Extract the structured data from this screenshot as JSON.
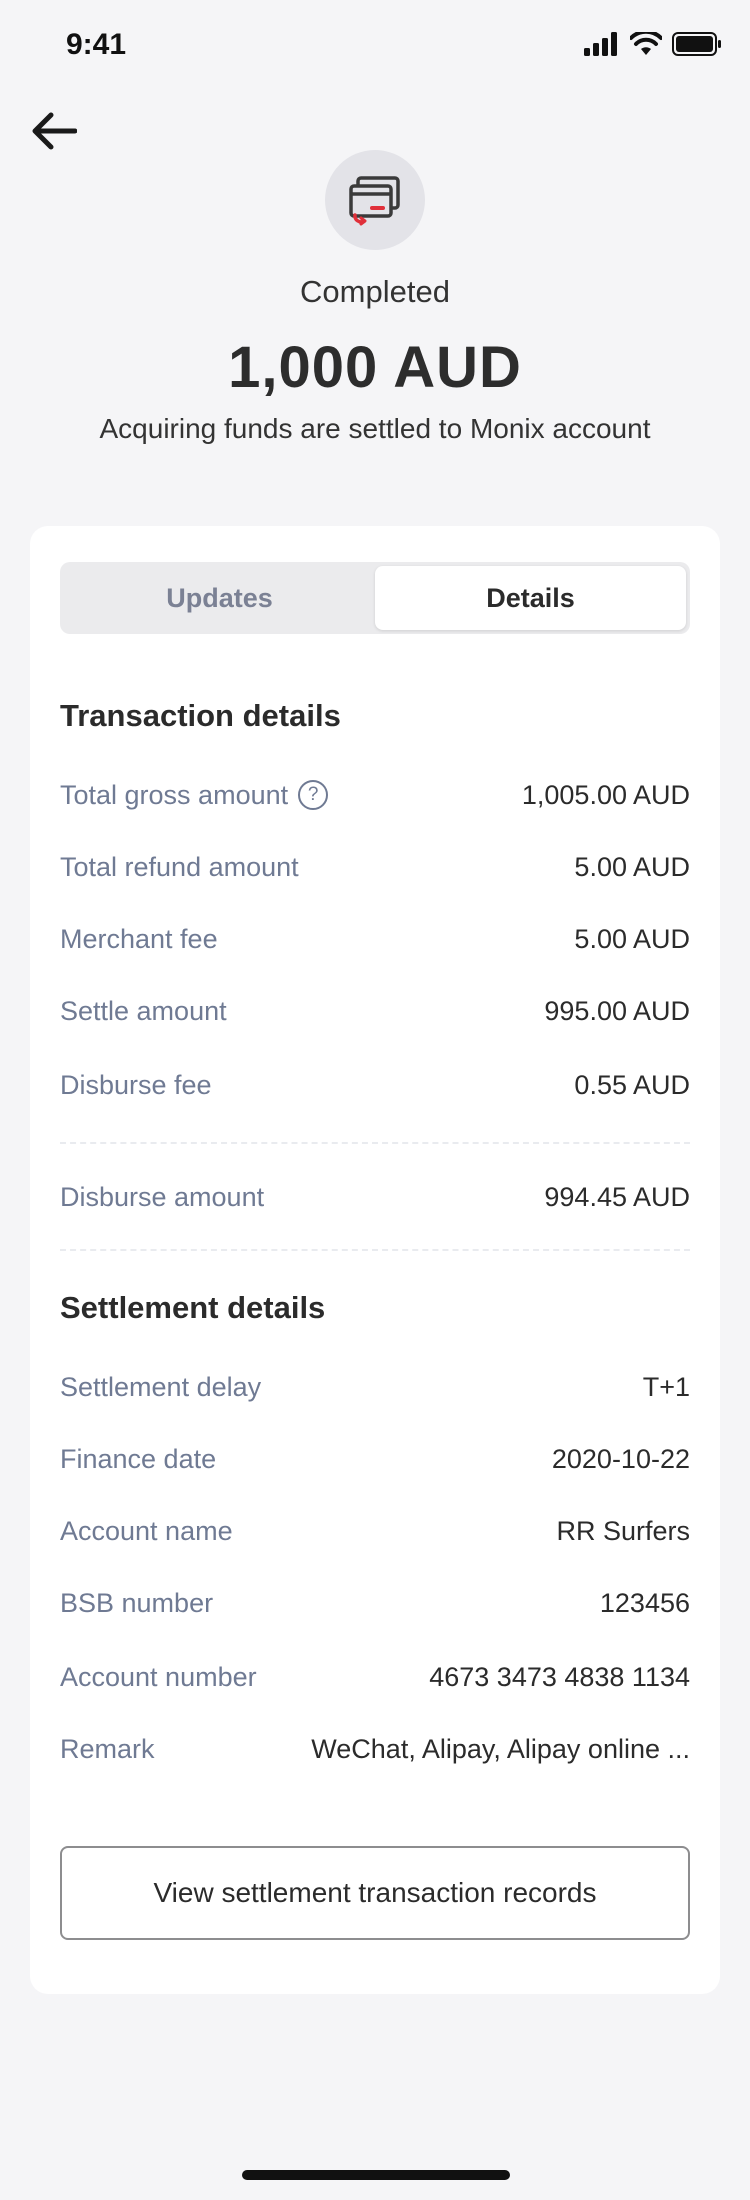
{
  "status_bar": {
    "time": "9:41"
  },
  "hero": {
    "status": "Completed",
    "amount": "1,000 AUD",
    "subtitle": "Acquiring funds are settled to Monix account"
  },
  "tabs": [
    {
      "label": "Updates",
      "active": false
    },
    {
      "label": "Details",
      "active": true
    }
  ],
  "transaction": {
    "title": "Transaction details",
    "help_glyph": "?",
    "rows": [
      {
        "label": "Total gross amount",
        "value": "1,005.00 AUD"
      },
      {
        "label": "Total refund amount",
        "value": "5.00 AUD"
      },
      {
        "label": "Merchant fee",
        "value": "5.00 AUD"
      },
      {
        "label": "Settle amount",
        "value": "995.00 AUD"
      },
      {
        "label": "Disburse fee",
        "value": "0.55 AUD"
      },
      {
        "label": "Disburse amount",
        "value": "994.45 AUD"
      }
    ]
  },
  "settlement": {
    "title": "Settlement details",
    "rows": [
      {
        "label": "Settlement delay",
        "value": "T+1"
      },
      {
        "label": "Finance date",
        "value": "2020-10-22"
      },
      {
        "label": "Account name",
        "value": "RR Surfers"
      },
      {
        "label": "BSB number",
        "value": "123456"
      },
      {
        "label": "Account number",
        "value": "4673 3473 4838 1134"
      },
      {
        "label": "Remark",
        "value": "WeChat, Alipay, Alipay online ..."
      }
    ]
  },
  "actions": {
    "view_records_label": "View settlement transaction records"
  },
  "icons": {
    "back": "arrow-left-icon",
    "hero": "card-refund-icon",
    "signal": "signal-icon",
    "wifi": "wifi-icon",
    "battery": "battery-icon",
    "help": "question-circle-icon"
  },
  "colors": {
    "background": "#f5f5f7",
    "card": "#ffffff",
    "label": "#6f7a93",
    "text": "#2b2b2b",
    "accent": "#e0303a"
  }
}
